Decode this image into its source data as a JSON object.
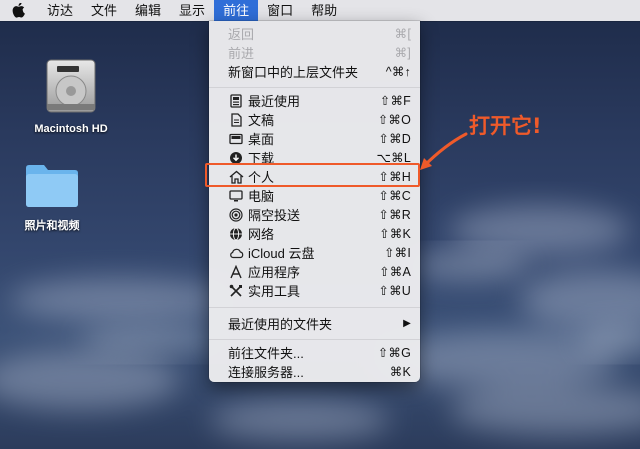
{
  "menubar": {
    "items": [
      "访达",
      "文件",
      "编辑",
      "显示",
      "前往",
      "窗口",
      "帮助"
    ],
    "active": "前往"
  },
  "desktop": {
    "hd_label": "Macintosh HD",
    "folder_label": "照片和视频"
  },
  "go_menu": {
    "back": {
      "label": "返回",
      "shortcut": "⌘["
    },
    "forward": {
      "label": "前进",
      "shortcut": "⌘]"
    },
    "enclosing": {
      "label": "新窗口中的上层文件夹",
      "shortcut": "^⌘↑"
    },
    "items": [
      {
        "label": "最近使用",
        "shortcut": "⇧⌘F",
        "icon": "recents-icon"
      },
      {
        "label": "文稿",
        "shortcut": "⇧⌘O",
        "icon": "documents-icon"
      },
      {
        "label": "桌面",
        "shortcut": "⇧⌘D",
        "icon": "desktop-icon"
      },
      {
        "label": "下载",
        "shortcut": "⌥⌘L",
        "icon": "downloads-icon"
      },
      {
        "label": "个人",
        "shortcut": "⇧⌘H",
        "icon": "home-icon"
      },
      {
        "label": "电脑",
        "shortcut": "⇧⌘C",
        "icon": "computer-icon"
      },
      {
        "label": "隔空投送",
        "shortcut": "⇧⌘R",
        "icon": "airdrop-icon"
      },
      {
        "label": "网络",
        "shortcut": "⇧⌘K",
        "icon": "network-icon"
      },
      {
        "label": "iCloud 云盘",
        "shortcut": "⇧⌘I",
        "icon": "icloud-icon"
      },
      {
        "label": "应用程序",
        "shortcut": "⇧⌘A",
        "icon": "applications-icon"
      },
      {
        "label": "实用工具",
        "shortcut": "⇧⌘U",
        "icon": "utilities-icon"
      }
    ],
    "recent_folders": {
      "label": "最近使用的文件夹",
      "arrow": "▶"
    },
    "go_to_folder": {
      "label": "前往文件夹...",
      "shortcut": "⇧⌘G"
    },
    "connect_server": {
      "label": "连接服务器...",
      "shortcut": "⌘K"
    }
  },
  "annotation": {
    "text": "打开它!",
    "color": "#ef5a2a"
  }
}
